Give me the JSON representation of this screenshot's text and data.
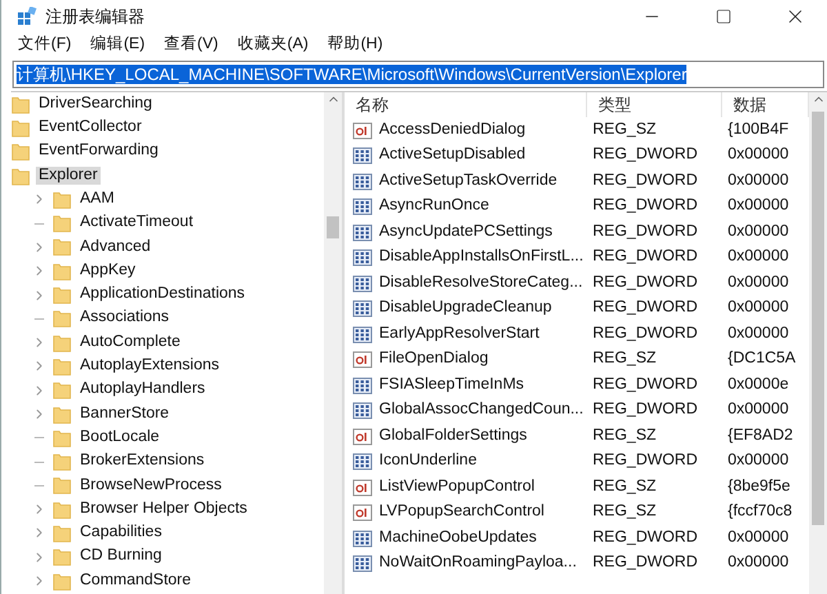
{
  "window": {
    "title": "注册表编辑器"
  },
  "menu": [
    "文件(F)",
    "编辑(E)",
    "查看(V)",
    "收藏夹(A)",
    "帮助(H)"
  ],
  "address": "计算机\\HKEY_LOCAL_MACHINE\\SOFTWARE\\Microsoft\\Windows\\CurrentVersion\\Explorer",
  "tree": [
    {
      "label": "DriverSearching",
      "selected": false
    },
    {
      "label": "EventCollector",
      "selected": false
    },
    {
      "label": "EventForwarding",
      "selected": false
    },
    {
      "label": "Explorer",
      "selected": true,
      "children": [
        {
          "label": "AAM",
          "expandable": true,
          "selected": false
        },
        {
          "label": "ActivateTimeout",
          "expandable": false,
          "selected": false
        },
        {
          "label": "Advanced",
          "expandable": true,
          "selected": false
        },
        {
          "label": "AppKey",
          "expandable": true,
          "selected": false
        },
        {
          "label": "ApplicationDestinations",
          "expandable": true,
          "selected": false
        },
        {
          "label": "Associations",
          "expandable": false,
          "selected": false
        },
        {
          "label": "AutoComplete",
          "expandable": true,
          "selected": false
        },
        {
          "label": "AutoplayExtensions",
          "expandable": true,
          "selected": false
        },
        {
          "label": "AutoplayHandlers",
          "expandable": true,
          "selected": false
        },
        {
          "label": "BannerStore",
          "expandable": true,
          "selected": false
        },
        {
          "label": "BootLocale",
          "expandable": false,
          "selected": false
        },
        {
          "label": "BrokerExtensions",
          "expandable": false,
          "selected": false
        },
        {
          "label": "BrowseNewProcess",
          "expandable": false,
          "selected": false
        },
        {
          "label": "Browser Helper Objects",
          "expandable": true,
          "selected": false
        },
        {
          "label": "Capabilities",
          "expandable": true,
          "selected": false
        },
        {
          "label": "CD Burning",
          "expandable": true,
          "selected": false
        },
        {
          "label": "CommandStore",
          "expandable": true,
          "selected": false
        }
      ]
    }
  ],
  "columns": [
    "名称",
    "类型",
    "数据"
  ],
  "values": [
    {
      "kind": "string",
      "name": "AccessDeniedDialog",
      "type": "REG_SZ",
      "data": "{100B4F"
    },
    {
      "kind": "binary",
      "name": "ActiveSetupDisabled",
      "type": "REG_DWORD",
      "data": "0x00000"
    },
    {
      "kind": "binary",
      "name": "ActiveSetupTaskOverride",
      "type": "REG_DWORD",
      "data": "0x00000"
    },
    {
      "kind": "binary",
      "name": "AsyncRunOnce",
      "type": "REG_DWORD",
      "data": "0x00000"
    },
    {
      "kind": "binary",
      "name": "AsyncUpdatePCSettings",
      "type": "REG_DWORD",
      "data": "0x00000"
    },
    {
      "kind": "binary",
      "name": "DisableAppInstallsOnFirstL...",
      "type": "REG_DWORD",
      "data": "0x00000"
    },
    {
      "kind": "binary",
      "name": "DisableResolveStoreCateg...",
      "type": "REG_DWORD",
      "data": "0x00000"
    },
    {
      "kind": "binary",
      "name": "DisableUpgradeCleanup",
      "type": "REG_DWORD",
      "data": "0x00000"
    },
    {
      "kind": "binary",
      "name": "EarlyAppResolverStart",
      "type": "REG_DWORD",
      "data": "0x00000"
    },
    {
      "kind": "string",
      "name": "FileOpenDialog",
      "type": "REG_SZ",
      "data": "{DC1C5A"
    },
    {
      "kind": "binary",
      "name": "FSIASleepTimeInMs",
      "type": "REG_DWORD",
      "data": "0x0000e"
    },
    {
      "kind": "binary",
      "name": "GlobalAssocChangedCoun...",
      "type": "REG_DWORD",
      "data": "0x00000"
    },
    {
      "kind": "string",
      "name": "GlobalFolderSettings",
      "type": "REG_SZ",
      "data": "{EF8AD2"
    },
    {
      "kind": "binary",
      "name": "IconUnderline",
      "type": "REG_DWORD",
      "data": "0x00000"
    },
    {
      "kind": "string",
      "name": "ListViewPopupControl",
      "type": "REG_SZ",
      "data": "{8be9f5e"
    },
    {
      "kind": "string",
      "name": "LVPopupSearchControl",
      "type": "REG_SZ",
      "data": "{fccf70c8"
    },
    {
      "kind": "binary",
      "name": "MachineOobeUpdates",
      "type": "REG_DWORD",
      "data": "0x00000"
    },
    {
      "kind": "binary",
      "name": "NoWaitOnRoamingPayloa...",
      "type": "REG_DWORD",
      "data": "0x00000"
    }
  ]
}
